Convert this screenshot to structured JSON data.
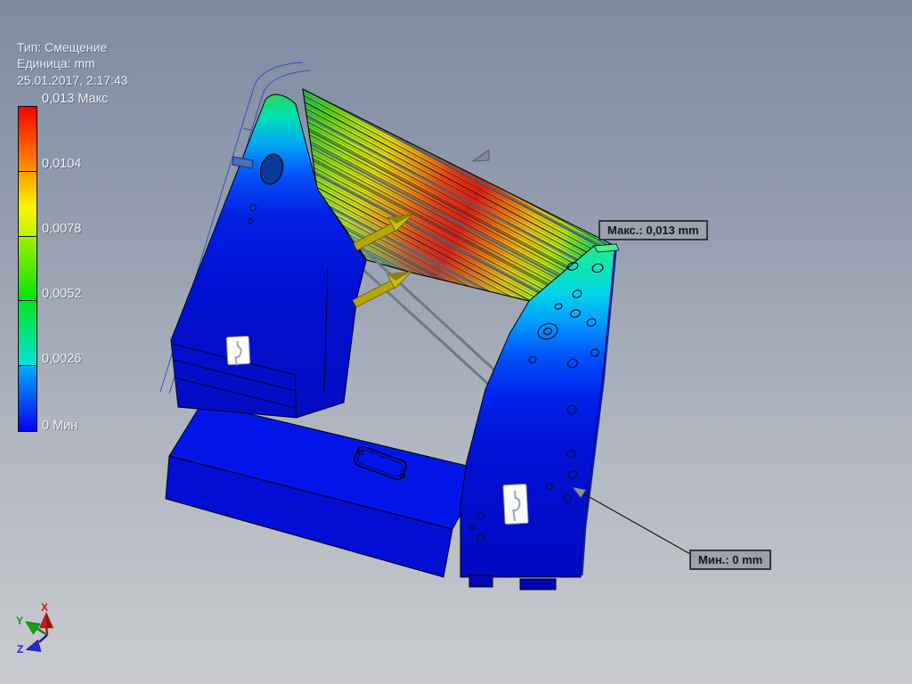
{
  "info_panel": {
    "type_line": "Тип: Смещение",
    "unit_line": "Единица: mm",
    "timestamp": "25.01.2017, 2:17:43"
  },
  "legend": {
    "max_label": "0,013 Макс",
    "tick_labels": [
      "0,0104",
      "0,0078",
      "0,0052",
      "0,0026"
    ],
    "min_label": "0 Мин",
    "scale_colors": [
      "#fa0202",
      "#ff9c02",
      "#f4e402",
      "#04e404",
      "#02e2da",
      "#0404f0"
    ]
  },
  "callouts": {
    "max": "Макс.: 0,013 mm",
    "min": "Мин.: 0 mm"
  },
  "triad": {
    "x": "X",
    "y": "Y",
    "z": "Z",
    "x_color": "#d01616",
    "y_color": "#0a9a0a",
    "z_color": "#2424e0"
  },
  "scene": {
    "displacement_max_color": "#fa1606",
    "displacement_min_color": "#0208c2",
    "load_arrow_color": "#ccbe12",
    "background_top": "#7e8ba1",
    "background_bottom": "#c9cbce"
  }
}
